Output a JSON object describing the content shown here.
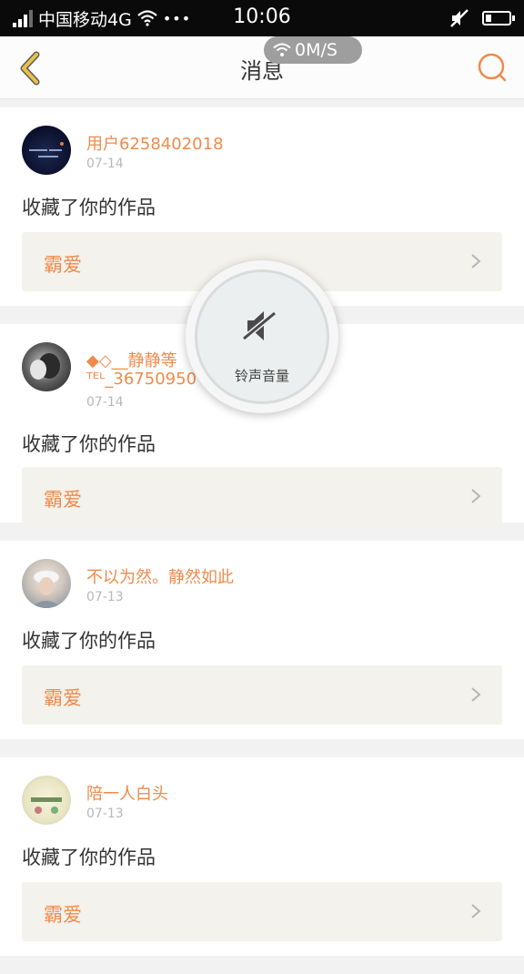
{
  "status_bar": {
    "carrier": "中国移动4G",
    "more": "•••",
    "time": "10:06"
  },
  "network_speed": "0M/S",
  "nav": {
    "title": "消息"
  },
  "messages": [
    {
      "username": "用户6258402018",
      "date": "07-14",
      "text": "收藏了你的作品",
      "work": "霸爱"
    },
    {
      "username": "◆◇__静静等",
      "username_line2": "ᵀᴱᴸ_36750950",
      "date": "07-14",
      "text": "收藏了你的作品",
      "work": "霸爱"
    },
    {
      "username": "不以为然。静然如此",
      "date": "07-13",
      "text": "收藏了你的作品",
      "work": "霸爱"
    },
    {
      "username": "陪一人白头",
      "date": "07-13",
      "text": "收藏了你的作品",
      "work": "霸爱"
    }
  ],
  "volume_overlay": {
    "label": "铃声音量"
  },
  "colors": {
    "accent": "#f08a4b",
    "back_arrow": "#e8c14a",
    "card_inner": "#f3f2ec"
  }
}
